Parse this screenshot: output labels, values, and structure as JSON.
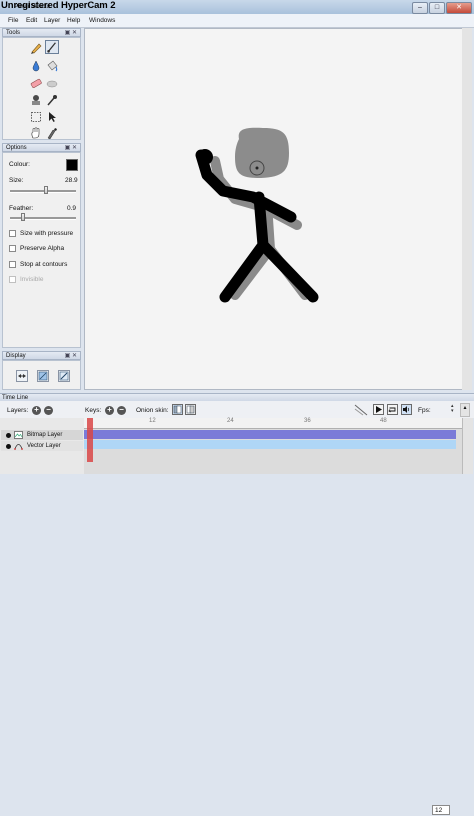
{
  "overlay": {
    "watermark": "Unregistered HyperCam 2"
  },
  "window": {
    "title": "Pencil Wxxxd",
    "controls": [
      "–",
      "□",
      "✕"
    ]
  },
  "menu": [
    "File",
    "Edit",
    "Layer",
    "Help",
    "Windows"
  ],
  "tools_panel": {
    "title": "Tools",
    "icons": [
      "pencil-icon",
      "brush-icon",
      "ink-drop-icon",
      "bucket-icon",
      "eraser-icon",
      "smudge-icon",
      "stamp-icon",
      "eyedropper-icon",
      "select-icon",
      "pointer-icon",
      "hand-icon",
      "pen-icon"
    ]
  },
  "options_panel": {
    "title": "Options",
    "colour_label": "Colour:",
    "colour_value": "#000000",
    "size_label": "Size:",
    "size_value": "28.9",
    "size_level": 0.55,
    "feather_label": "Feather:",
    "feather_value": "0.9",
    "feather_level": 0.2,
    "checkboxes": [
      {
        "label": "Size with pressure",
        "checked": false,
        "disabled": false
      },
      {
        "label": "Preserve Alpha",
        "checked": false,
        "disabled": false
      },
      {
        "label": "Stop at contours",
        "checked": false,
        "disabled": false
      },
      {
        "label": "Invisible",
        "checked": false,
        "disabled": true
      }
    ]
  },
  "display_panel": {
    "title": "Display",
    "icons": [
      "flip-horizontal-icon",
      "flip-vertical-icon",
      "diagonal-icon"
    ]
  },
  "timeline": {
    "title": "Time Line",
    "layers_label": "Layers:",
    "keys_label": "Keys:",
    "onion_label": "Onion skin:",
    "fps_label": "Fps:",
    "fps_value": "12",
    "ruler_ticks": [
      "12",
      "24",
      "36",
      "48"
    ],
    "layers": [
      {
        "name": "Bitmap Layer",
        "type": "bitmap"
      },
      {
        "name": "Vector Layer",
        "type": "vector"
      }
    ]
  },
  "colors": {
    "bitmap_track": "#7b7bd8",
    "vector_track": "#afd6f6",
    "playhead": "#d94747"
  }
}
